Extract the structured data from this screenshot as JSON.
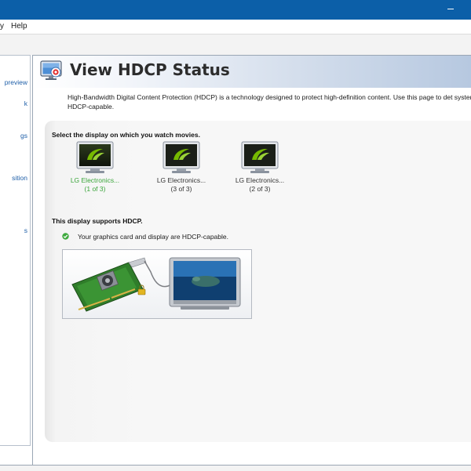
{
  "titlebar": {
    "minimize_glyph": "—"
  },
  "menubar": {
    "items": [
      "y",
      "Help"
    ]
  },
  "sidebar": {
    "items": [
      {
        "label": "preview"
      },
      {
        "label": "k"
      },
      {
        "label": "gs"
      },
      {
        "label": "sition"
      },
      {
        "label": "s"
      }
    ]
  },
  "banner": {
    "title": "View HDCP Status",
    "icon": "hdcp-monitor-icon"
  },
  "description": "High-Bandwidth Digital Content Protection (HDCP) is a technology designed to protect high-definition content. Use this page to det system is HDCP-capable.",
  "select_label": "Select the display on which you watch movies.",
  "displays": [
    {
      "name": "LG Electronics...",
      "index": "(1 of 3)",
      "selected": true
    },
    {
      "name": "LG Electronics...",
      "index": "(3 of 3)",
      "selected": false
    },
    {
      "name": "LG Electronics...",
      "index": "(2 of 3)",
      "selected": false
    }
  ],
  "support_label": "This display supports HDCP.",
  "status_message": "Your graphics card and display are HDCP-capable.",
  "colors": {
    "titlebar": "#0c5fa8",
    "link": "#1f5fa8",
    "selected_label": "#3aa53a",
    "nvidia_green": "#76b900"
  }
}
